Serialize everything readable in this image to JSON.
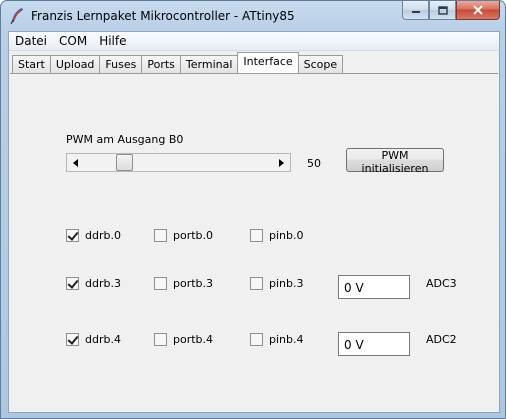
{
  "window": {
    "title": "Franzis Lernpaket Mikrocontroller - ATtiny85"
  },
  "menu": [
    "Datei",
    "COM",
    "Hilfe"
  ],
  "tabs": [
    {
      "label": "Start",
      "active": false
    },
    {
      "label": "Upload",
      "active": false
    },
    {
      "label": "Fuses",
      "active": false
    },
    {
      "label": "Ports",
      "active": false
    },
    {
      "label": "Terminal",
      "active": false
    },
    {
      "label": "Interface",
      "active": true
    },
    {
      "label": "Scope",
      "active": false
    }
  ],
  "pwm": {
    "label": "PWM am Ausgang B0",
    "value": "50",
    "button_label": "PWM initialisieren"
  },
  "rows": [
    {
      "ddrb": {
        "label": "ddrb.0",
        "checked": true
      },
      "portb": {
        "label": "portb.0",
        "checked": false
      },
      "pinb": {
        "label": "pinb.0",
        "checked": false
      }
    },
    {
      "ddrb": {
        "label": "ddrb.3",
        "checked": true
      },
      "portb": {
        "label": "portb.3",
        "checked": false
      },
      "pinb": {
        "label": "pinb.3",
        "checked": false
      },
      "field_value": "0 V",
      "adc_label": "ADC3"
    },
    {
      "ddrb": {
        "label": "ddrb.4",
        "checked": true
      },
      "portb": {
        "label": "portb.4",
        "checked": false
      },
      "pinb": {
        "label": "pinb.4",
        "checked": false
      },
      "field_value": "0 V",
      "adc_label": "ADC2"
    }
  ],
  "icons": {
    "app": "feather-pen-icon",
    "minimize": "minimize-icon",
    "maximize": "maximize-icon",
    "close": "close-icon",
    "slider_left": "arrow-left-icon",
    "slider_right": "arrow-right-icon"
  }
}
